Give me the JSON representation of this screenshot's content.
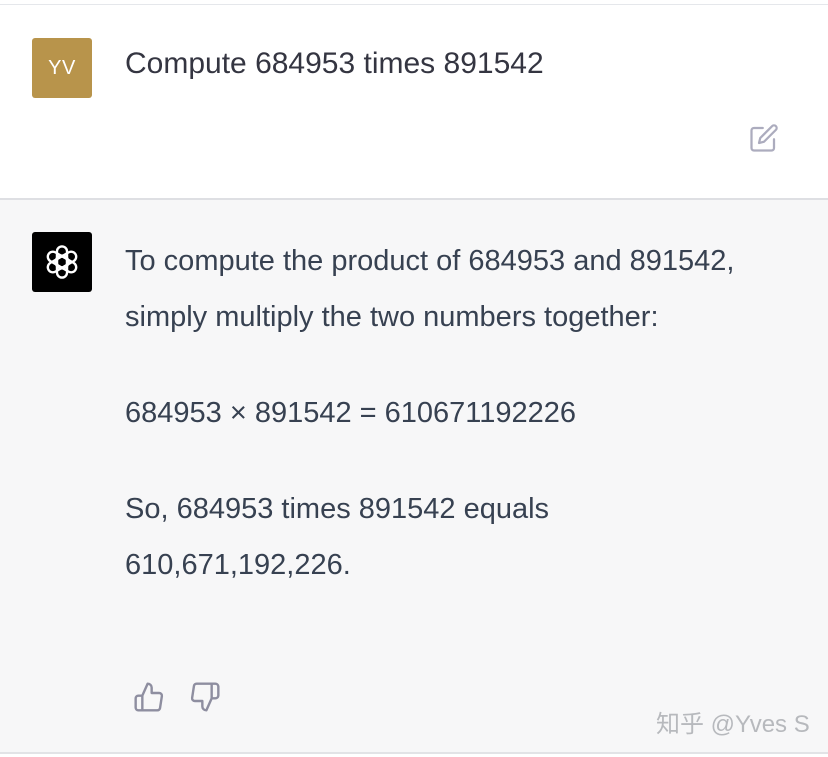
{
  "user_message": {
    "avatar_initials": "YV",
    "avatar_color": "#b8944b",
    "text": "Compute 684953 times 891542",
    "edit_icon": "edit-icon"
  },
  "assistant_message": {
    "avatar_icon": "openai-logo-icon",
    "paragraphs": [
      "To compute the product of 684953 and 891542, simply multiply the two numbers together:",
      "684953 × 891542 = 610671192226",
      "So, 684953 times 891542 equals 610,671,192,226."
    ],
    "feedback_icons": [
      "thumbs-up-icon",
      "thumbs-down-icon"
    ]
  },
  "watermark": "知乎 @Yves S",
  "colors": {
    "assistant_background": "#f7f7f8",
    "user_background": "#ffffff",
    "text": "#374151",
    "icon": "#acacbe"
  }
}
